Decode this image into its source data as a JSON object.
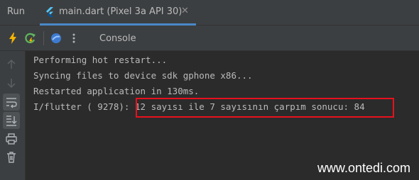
{
  "tabbar": {
    "run_label": "Run",
    "tab_title": "main.dart (Pixel 3a API 30)",
    "tab_icon": "flutter-icon",
    "close_glyph": "✕"
  },
  "toolbar": {
    "console_label": "Console",
    "icons": [
      "hot-reload-icon",
      "hot-restart-icon",
      "devtools-icon",
      "more-options-icon"
    ]
  },
  "gutter": {
    "icons": [
      "scroll-up-icon",
      "scroll-down-icon",
      "soft-wrap-icon",
      "scroll-to-end-icon",
      "print-icon",
      "clear-all-icon"
    ]
  },
  "console": {
    "lines": [
      "Performing hot restart...",
      "Syncing files to device sdk gphone x86...",
      "Restarted application in 130ms.",
      "I/flutter ( 9278): 12 sayısı ile 7 sayısının çarpım sonucu: 84"
    ],
    "highlight_color": "#e8111d"
  },
  "watermark": "www.ontedi.com",
  "colors": {
    "background": "#2b2b2b",
    "panel": "#3c3f41",
    "text": "#bbbbbb",
    "accent": "#4a88c7"
  }
}
